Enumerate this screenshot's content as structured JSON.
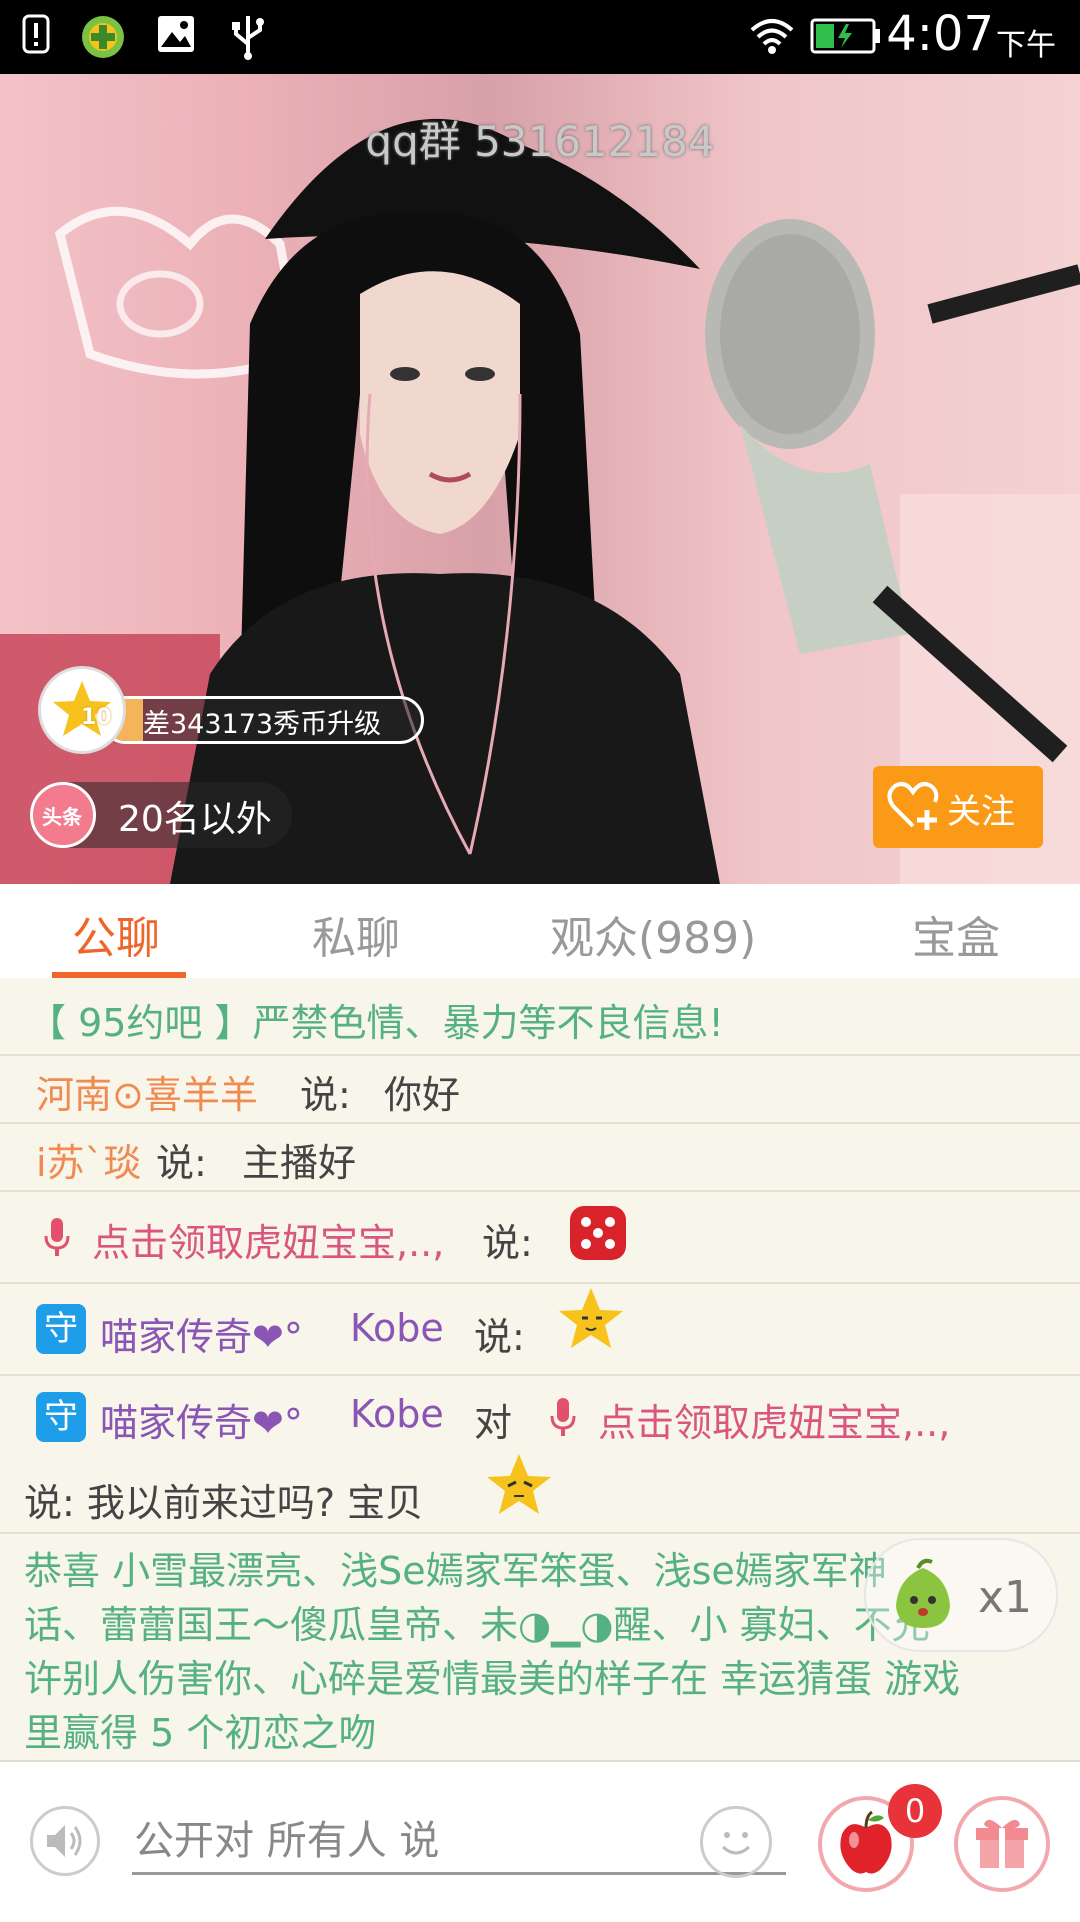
{
  "status_bar": {
    "time": "4:07",
    "ampm": "下午",
    "icons": [
      "alert-icon",
      "360-security-icon",
      "image-icon",
      "usb-icon",
      "wifi-icon",
      "battery-charging-icon"
    ]
  },
  "video": {
    "watermark": "qq群 531612184",
    "level": "10",
    "upgrade_text": "差343173秀币升级",
    "upgrade_progress": 0.12,
    "rank_badge": "头条",
    "rank_text": "20名以外",
    "follow_label": "关注"
  },
  "tabs": [
    {
      "label": "公聊",
      "active": true
    },
    {
      "label": "私聊",
      "active": false
    },
    {
      "label": "观众(989)",
      "active": false
    },
    {
      "label": "宝盒",
      "active": false
    }
  ],
  "chat": {
    "notice": "【 95约吧 】严禁色情、暴力等不良信息!",
    "msg1": {
      "user": "河南⊙喜羊羊",
      "verb": "说:",
      "text": "你好"
    },
    "msg2": {
      "user": "i苏`琰",
      "verb": "说:",
      "text": "主播好"
    },
    "msg3": {
      "user": "点击领取虎妞宝宝,..,",
      "verb": "说:",
      "emoji": "dice-emoji"
    },
    "msg4": {
      "guard": "守",
      "user_a": "喵家传奇❤°",
      "user_b": "Kobe",
      "verb": "说:",
      "emoji": "star-emoji"
    },
    "msg5": {
      "guard": "守",
      "user_a": "喵家传奇❤°",
      "user_b": "Kobe",
      "verb": "对",
      "target": "点击领取虎妞宝宝,..,",
      "line2": "说: 我以前来过吗? 宝贝"
    },
    "congrats": [
      "恭喜 小雪最漂亮、浅Se嫣家军笨蛋、浅se嫣家军神",
      "话、蕾蕾国王～傻瓜皇帝、未◑▁◑醒、小 寡妇、不允",
      "许别人伤害你、心碎是爱情最美的样子在 幸运猜蛋 游戏",
      "里赢得 5 个初恋之吻"
    ],
    "combo": "x1"
  },
  "bottom_bar": {
    "input_placeholder": "公开对 所有人 说",
    "apple_count": "0"
  }
}
